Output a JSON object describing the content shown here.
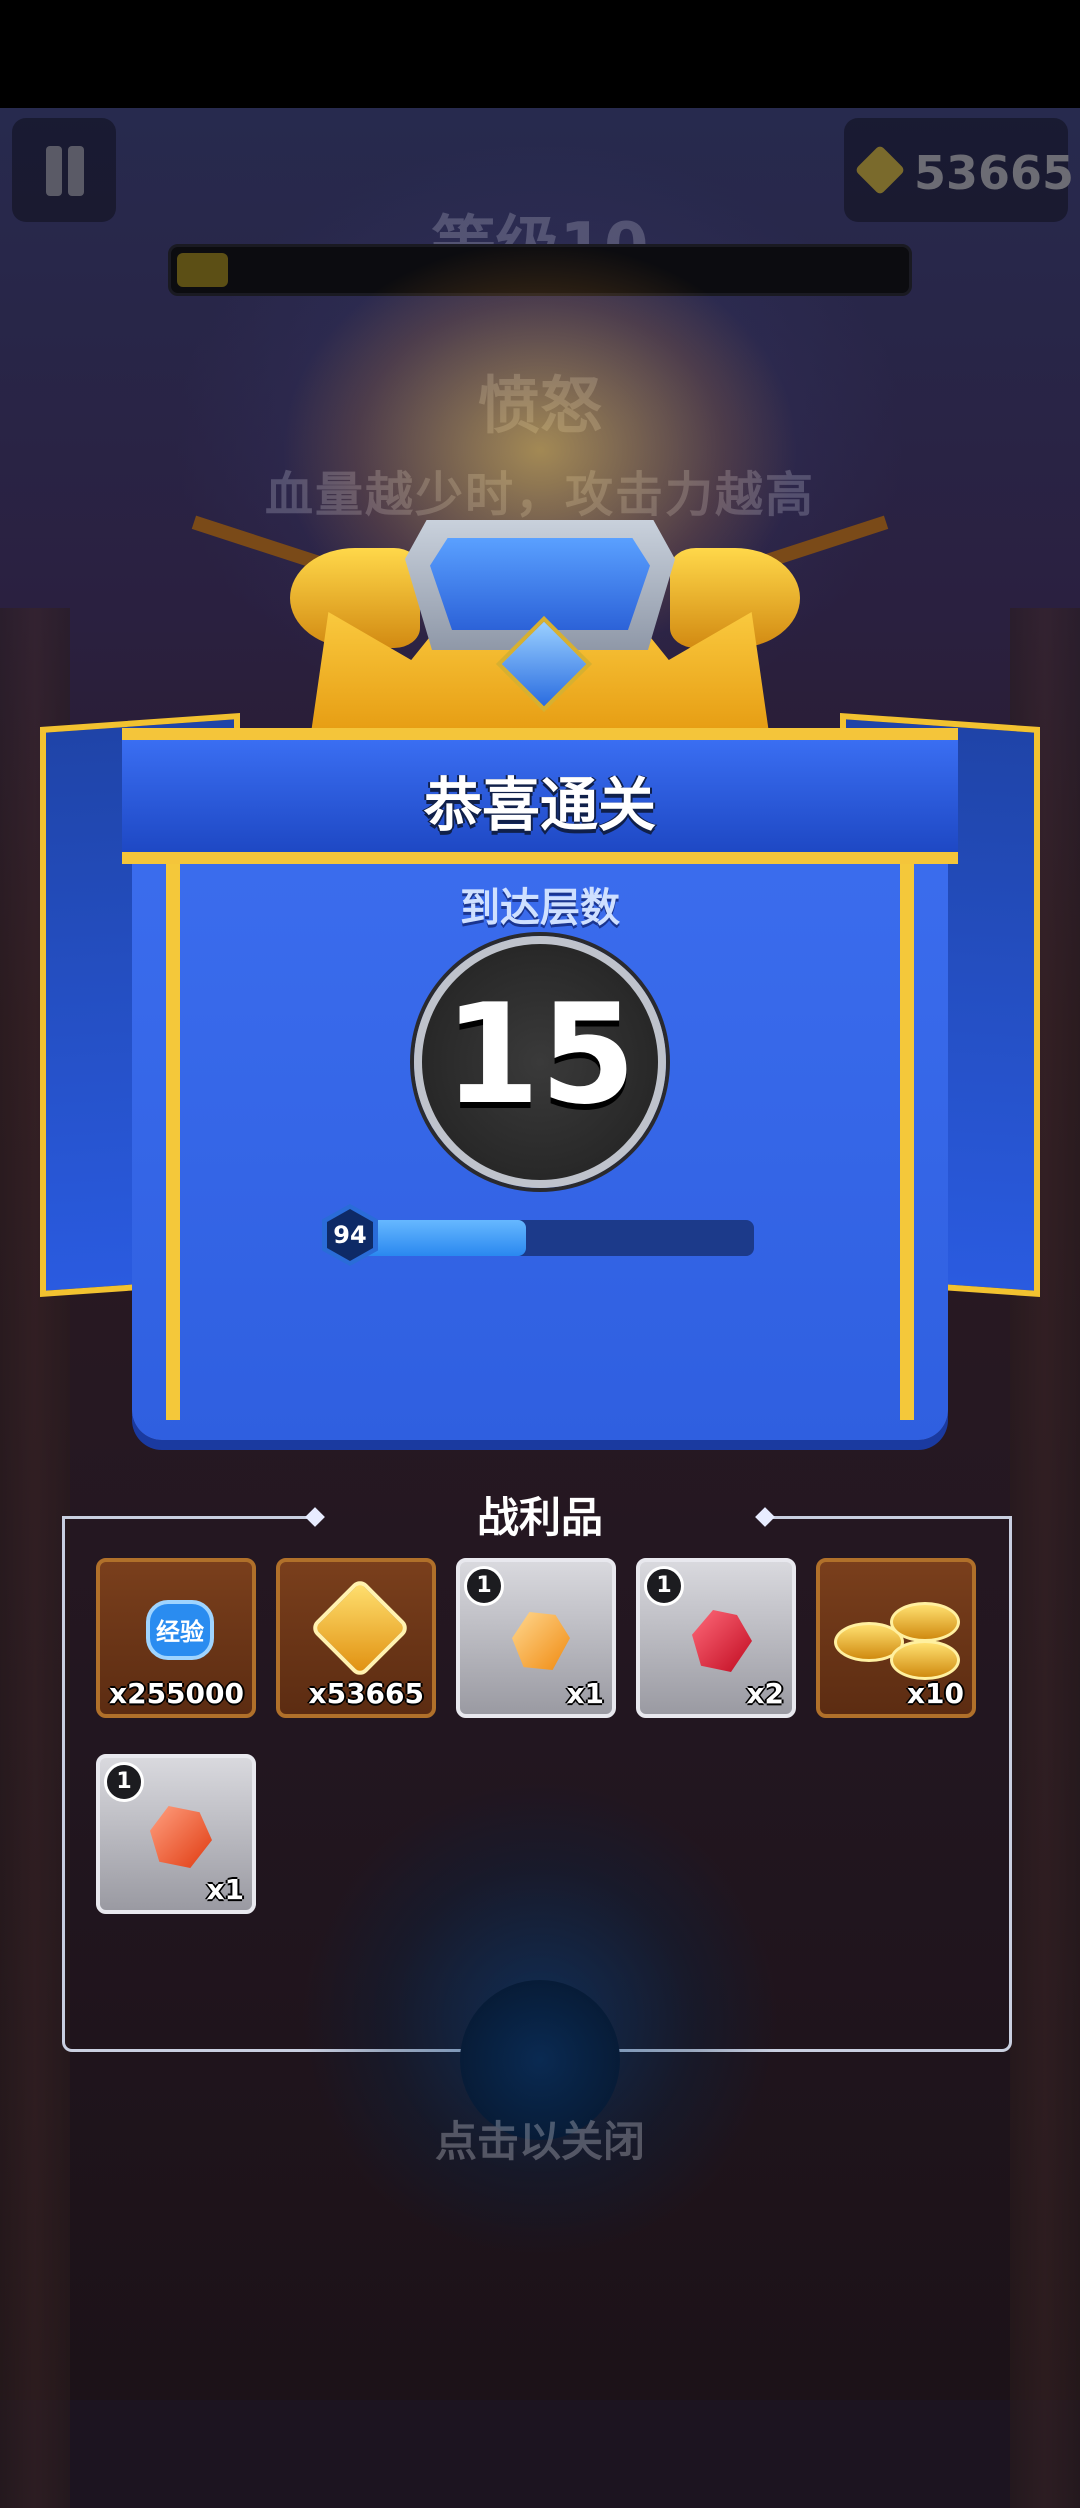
{
  "hud": {
    "currency_value": "53665",
    "level_title": "等级10",
    "level_progress": 0.07
  },
  "skill": {
    "name": "愤怒",
    "description": "血量越少时，攻击力越高"
  },
  "result": {
    "title": "恭喜通关",
    "floor_label": "到达层数",
    "floor_value": "15",
    "player_level": "94",
    "player_progress": 0.45
  },
  "loot": {
    "title": "战利品",
    "items": [
      {
        "icon": "exp-badge-icon",
        "label": "经验",
        "qty": "x255000",
        "style": "brown"
      },
      {
        "icon": "gold-bow-coin-icon",
        "qty": "x53665",
        "style": "brown"
      },
      {
        "icon": "orange-gem-icon",
        "badge": "1",
        "qty": "x1",
        "style": "grey"
      },
      {
        "icon": "red-gem-icon",
        "badge": "1",
        "qty": "x2",
        "style": "grey"
      },
      {
        "icon": "gold-coins-icon",
        "qty": "x10",
        "style": "brown"
      },
      {
        "icon": "red-orange-gem-icon",
        "badge": "1",
        "qty": "x1",
        "style": "grey"
      }
    ]
  },
  "close_hint": "点击以关闭",
  "colors": {
    "panel_blue": "#2f5fe0",
    "gold_trim": "#f4c53a",
    "loot_brown": "#7a3f1c",
    "loot_grey": "#c0c0c6"
  }
}
